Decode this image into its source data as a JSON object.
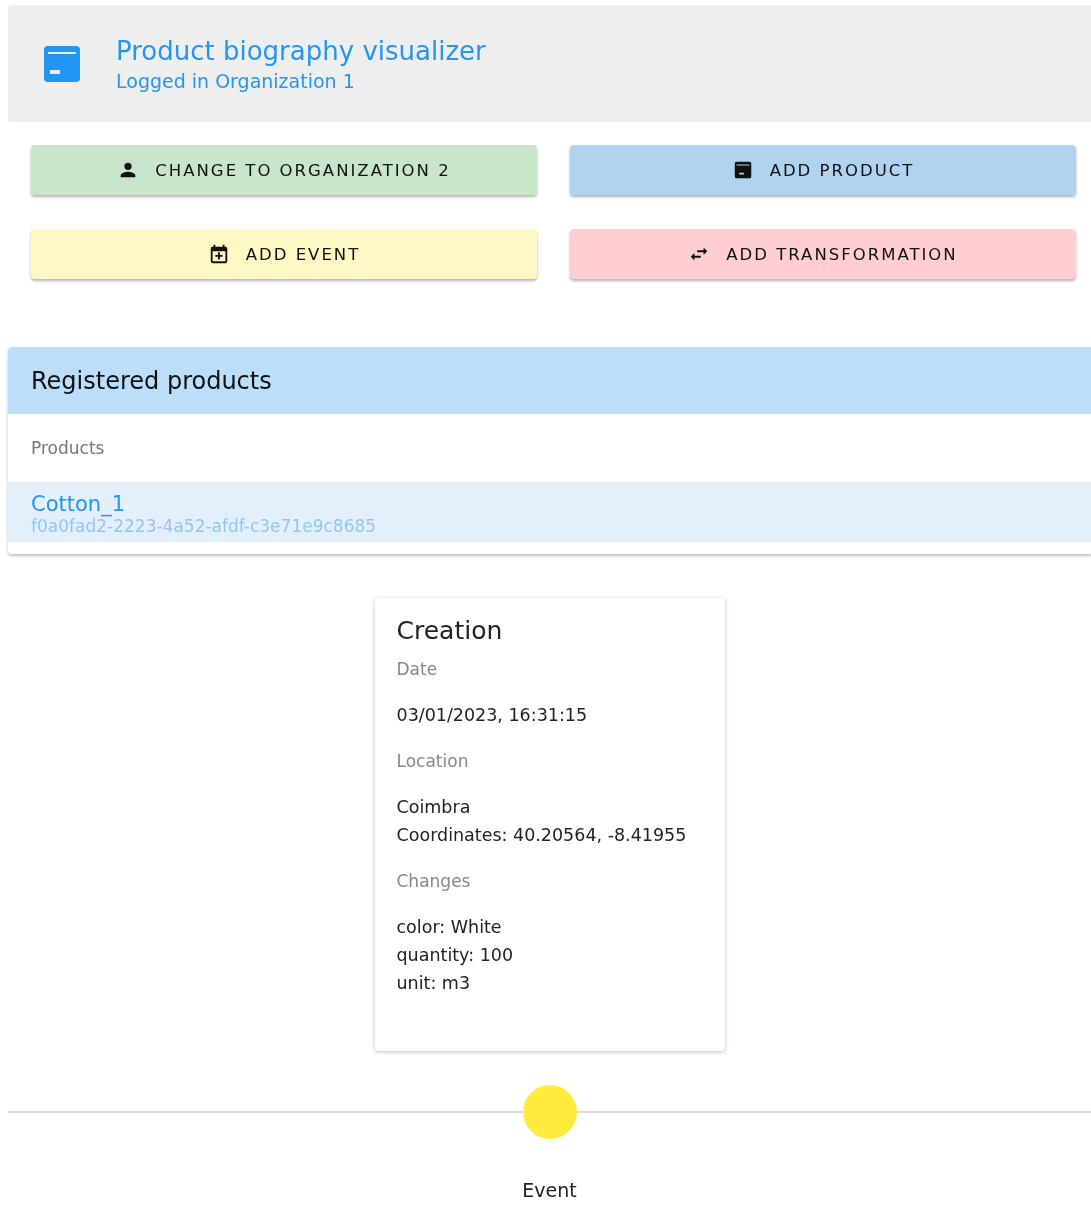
{
  "header": {
    "title": "Product biography visualizer",
    "subtitle": "Logged in Organization 1"
  },
  "actions": [
    {
      "label": "CHANGE TO ORGANIZATION 2",
      "kind": "person",
      "color": "#c8e6c9"
    },
    {
      "label": "ADD PRODUCT",
      "kind": "product",
      "color": "#b1d3f0"
    },
    {
      "label": "ADD EVENT",
      "kind": "event",
      "color": "#fff8c4"
    },
    {
      "label": "ADD TRANSFORMATION",
      "kind": "transformation",
      "color": "#ffcdd2"
    }
  ],
  "products_panel": {
    "title": "Registered products",
    "subheader": "Products",
    "items": [
      {
        "name": "Cotton_1",
        "id": "f0a0fad2-2223-4a52-afdf-c3e71e9c8685",
        "selected": true
      }
    ]
  },
  "event_card": {
    "title": "Creation",
    "sections": [
      {
        "label": "Date",
        "lines": [
          "03/01/2023, 16:31:15"
        ]
      },
      {
        "label": "Location",
        "lines": [
          "Coimbra",
          "Coordinates: 40.20564, -8.41955"
        ]
      },
      {
        "label": "Changes",
        "lines": [
          "color: White",
          "quantity: 100",
          "unit: m3"
        ]
      }
    ]
  },
  "timeline": {
    "points": [
      {
        "label": "Event",
        "color": "#ffeb3b"
      }
    ]
  }
}
